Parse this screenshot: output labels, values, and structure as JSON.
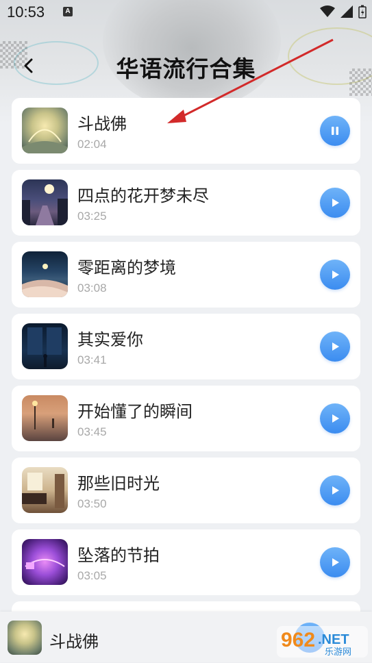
{
  "status": {
    "time": "10:53",
    "a_label": "A"
  },
  "header": {
    "title": "华语流行合集"
  },
  "songs": [
    {
      "title": "斗战佛",
      "duration": "02:04",
      "state": "playing",
      "cover": "cloud-mountain"
    },
    {
      "title": "四点的花开梦未尽",
      "duration": "03:25",
      "state": "paused",
      "cover": "night-street"
    },
    {
      "title": "零距离的梦境",
      "duration": "03:08",
      "state": "paused",
      "cover": "moon-sea"
    },
    {
      "title": "其实爱你",
      "duration": "03:41",
      "state": "paused",
      "cover": "rain-window"
    },
    {
      "title": "开始懂了的瞬间",
      "duration": "03:45",
      "state": "paused",
      "cover": "foggy-lamp"
    },
    {
      "title": "那些旧时光",
      "duration": "03:50",
      "state": "paused",
      "cover": "old-room"
    },
    {
      "title": "坠落的节拍",
      "duration": "03:05",
      "state": "paused",
      "cover": "neon-purple"
    }
  ],
  "player": {
    "title": "斗战佛"
  },
  "watermark": {
    "number": "962",
    "suffix": ".NET",
    "sub": "乐游网"
  },
  "colors": {
    "accent": "#3b8cf0",
    "arrow": "#d22a2a"
  }
}
